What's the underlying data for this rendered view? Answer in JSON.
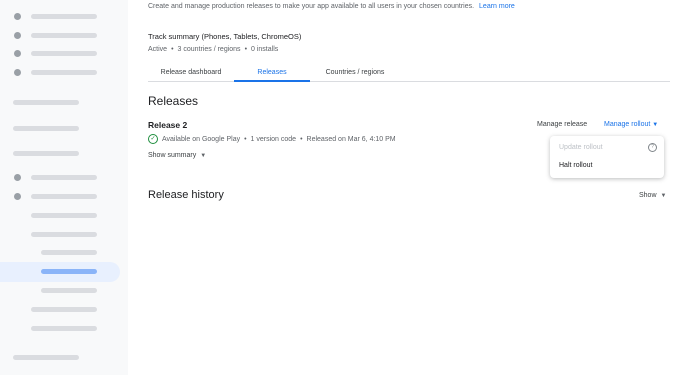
{
  "intro": {
    "text": "Create and manage production releases to make your app available to all users in your chosen countries.",
    "link": "Learn more"
  },
  "track": {
    "title": "Track summary (Phones, Tablets, ChromeOS)",
    "status": "Active",
    "countries": "3 countries / regions",
    "installs": "0 installs"
  },
  "tabs": [
    "Release dashboard",
    "Releases",
    "Countries / regions"
  ],
  "releases": {
    "heading": "Releases",
    "name": "Release 2",
    "availability": "Available on Google Play",
    "version_codes": "1 version code",
    "released": "Released on Mar 6, 4:10 PM",
    "show_summary": "Show summary"
  },
  "actions": {
    "manage_release": "Manage release",
    "manage_rollout": "Manage rollout"
  },
  "menu": {
    "update": "Update rollout",
    "halt": "Halt rollout"
  },
  "history": {
    "heading": "Release history",
    "show": "Show"
  },
  "colors": {
    "accent": "#1a73e8",
    "success": "#1e8e3e"
  }
}
